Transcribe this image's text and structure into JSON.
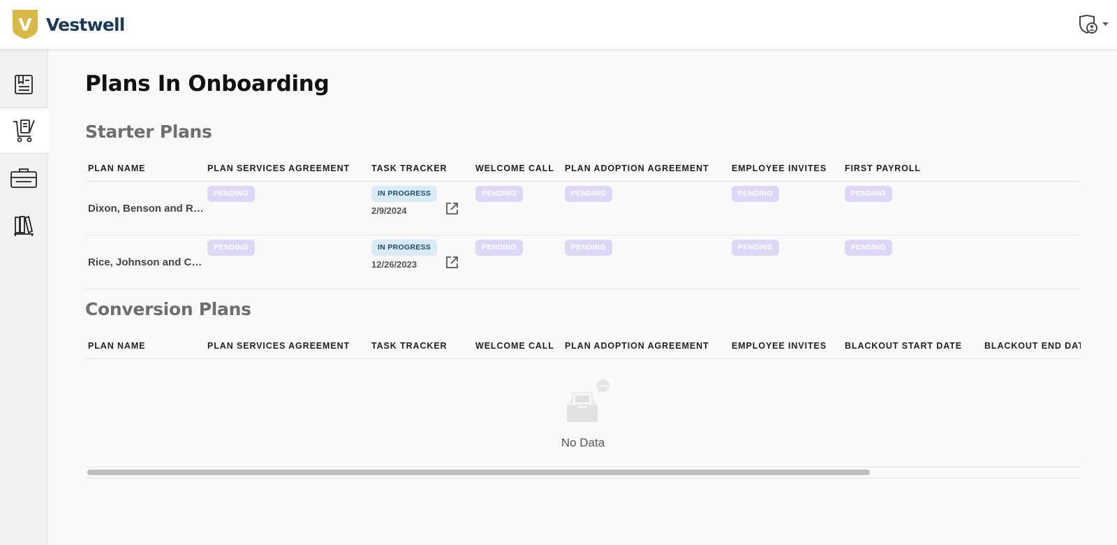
{
  "app": {
    "brand_name": "Vestwell",
    "brand_mark": "V",
    "brand_color": "#d9b945",
    "brand_text_color": "#1b3a57"
  },
  "header": {
    "user_menu_icon": "shield-user-icon",
    "dropdown_icon": "caret-down-icon"
  },
  "sidebar": {
    "items": [
      {
        "name": "sidebar-item-documents",
        "icon": "clipboard-list-icon",
        "active": false
      },
      {
        "name": "sidebar-item-onboarding",
        "icon": "cart-document-icon",
        "active": true
      },
      {
        "name": "sidebar-item-plans",
        "icon": "briefcase-icon",
        "active": false
      },
      {
        "name": "sidebar-item-library",
        "icon": "books-icon",
        "active": false
      }
    ]
  },
  "page": {
    "title": "Plans In Onboarding"
  },
  "starter": {
    "title": "Starter Plans",
    "columns": [
      "PLAN NAME",
      "PLAN SERVICES AGREEMENT",
      "TASK TRACKER",
      "WELCOME CALL",
      "PLAN ADOPTION AGREEMENT",
      "EMPLOYEE INVITES",
      "FIRST PAYROLL"
    ],
    "rows": [
      {
        "plan_name": "Dixon, Benson and Rodriguez",
        "plan_services_agreement": "PENDING",
        "task_tracker_status": "IN PROGRESS",
        "task_tracker_date": "2/9/2024",
        "welcome_call": "PENDING",
        "plan_adoption_agreement": "PENDING",
        "employee_invites": "PENDING",
        "first_payroll": "PENDING"
      },
      {
        "plan_name": "Rice, Johnson and Campbell",
        "plan_services_agreement": "PENDING",
        "task_tracker_status": "IN PROGRESS",
        "task_tracker_date": "12/26/2023",
        "welcome_call": "PENDING",
        "plan_adoption_agreement": "PENDING",
        "employee_invites": "PENDING",
        "first_payroll": "PENDING"
      }
    ]
  },
  "conversion": {
    "title": "Conversion Plans",
    "columns": [
      "PLAN NAME",
      "PLAN SERVICES AGREEMENT",
      "TASK TRACKER",
      "WELCOME CALL",
      "PLAN ADOPTION AGREEMENT",
      "EMPLOYEE INVITES",
      "BLACKOUT START DATE",
      "BLACKOUT END DATE"
    ],
    "empty_text": "No Data",
    "empty_icon": "empty-inbox-icon"
  },
  "colors": {
    "pending_badge": "#ddd6f7",
    "in_progress_badge": "#d8ebf7",
    "in_progress_text": "#1d4869"
  }
}
